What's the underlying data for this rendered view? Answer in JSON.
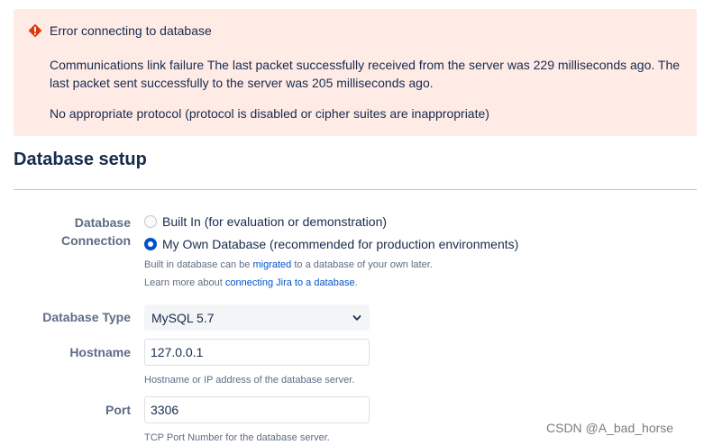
{
  "error": {
    "title": "Error connecting to database",
    "message": "Communications link failure The last packet successfully received from the server was 229 milliseconds ago. The last packet sent successfully to the server was 205 milliseconds ago.",
    "detail": "No appropriate protocol (protocol is disabled or cipher suites are inappropriate)",
    "icon": "error-icon",
    "color": "#de350b"
  },
  "section_title": "Database setup",
  "connection": {
    "label_line1": "Database",
    "label_line2": "Connection",
    "options": [
      {
        "label": "Built In (for evaluation or demonstration)",
        "selected": false
      },
      {
        "label": "My Own Database (recommended for production environments)",
        "selected": true
      }
    ],
    "help1_prefix": "Built in database can be ",
    "help1_link": "migrated",
    "help1_suffix": " to a database of your own later.",
    "help2_prefix": "Learn more about ",
    "help2_link": "connecting Jira to a database",
    "help2_suffix": "."
  },
  "database_type": {
    "label": "Database Type",
    "value": "MySQL 5.7"
  },
  "hostname": {
    "label": "Hostname",
    "value": "127.0.0.1",
    "help": "Hostname or IP address of the database server."
  },
  "port": {
    "label": "Port",
    "value": "3306",
    "help": "TCP Port Number for the database server."
  },
  "watermark": "CSDN @A_bad_horse",
  "colors": {
    "accent": "#0052cc",
    "error_bg": "#ffebe6",
    "label": "#5e6c84"
  }
}
